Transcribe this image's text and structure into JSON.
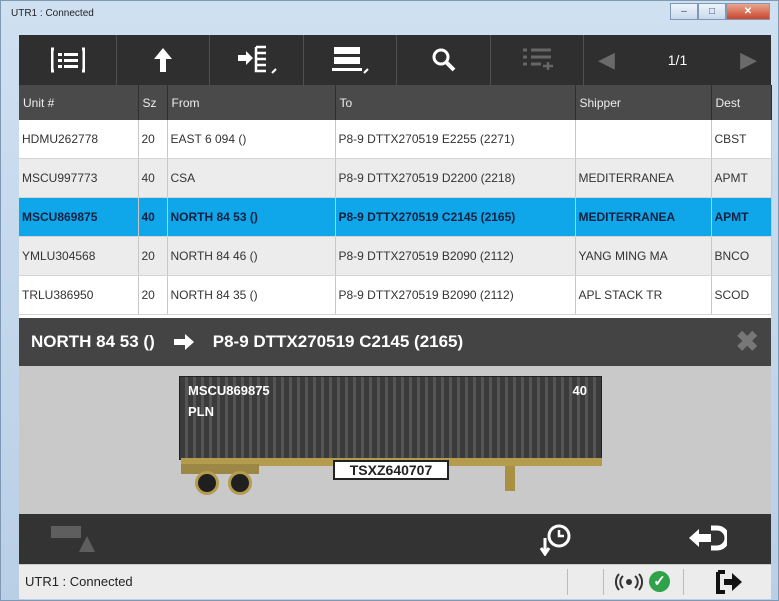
{
  "window": {
    "title": "UTR1 : Connected"
  },
  "toolbar": {
    "buttons": [
      {
        "name": "list-view",
        "icon": "list-icon"
      },
      {
        "name": "up",
        "icon": "arrow-up-icon"
      },
      {
        "name": "import",
        "icon": "import-icon"
      },
      {
        "name": "stack",
        "icon": "stack-icon"
      },
      {
        "name": "search",
        "icon": "search-icon"
      },
      {
        "name": "filter",
        "icon": "filter-list-icon"
      }
    ],
    "pager": {
      "prev": "◀",
      "page": "1/1",
      "next": "▶"
    }
  },
  "table": {
    "columns": [
      "Unit #",
      "Sz",
      "From",
      "To",
      "Shipper",
      "Dest"
    ],
    "rows": [
      [
        "HDMU262778",
        "20",
        "EAST 6 094 ()",
        "P8-9 DTTX270519 E2255 (2271)",
        "",
        "CBST"
      ],
      [
        "MSCU997773",
        "40",
        "CSA",
        "P8-9 DTTX270519 D2200 (2218)",
        "MEDITERRANEA",
        "APMT"
      ],
      [
        "MSCU869875",
        "40",
        "NORTH 84 53 ()",
        "P8-9 DTTX270519 C2145 (2165)",
        "MEDITERRANEA",
        "APMT"
      ],
      [
        "YMLU304568",
        "20",
        "NORTH 84 46 ()",
        "P8-9 DTTX270519 B2090 (2112)",
        "YANG MING MA",
        "BNCO"
      ],
      [
        "TRLU386950",
        "20",
        "NORTH 84 35 ()",
        "P8-9 DTTX270519 B2090 (2112)",
        "APL STACK TR",
        "SCOD"
      ]
    ]
  },
  "route": {
    "from": "NORTH 84 53 ()",
    "to": "P8-9 DTTX270519 C2145 (2165)"
  },
  "container": {
    "id": "MSCU869875",
    "type": "PLN",
    "size": "40",
    "chassis": "TSXZ640707"
  },
  "status": {
    "text": "UTR1 : Connected"
  },
  "colors": {
    "selected": "#10a6ea",
    "toolbar": "#2f2f2f",
    "ok": "#2fa24a"
  }
}
